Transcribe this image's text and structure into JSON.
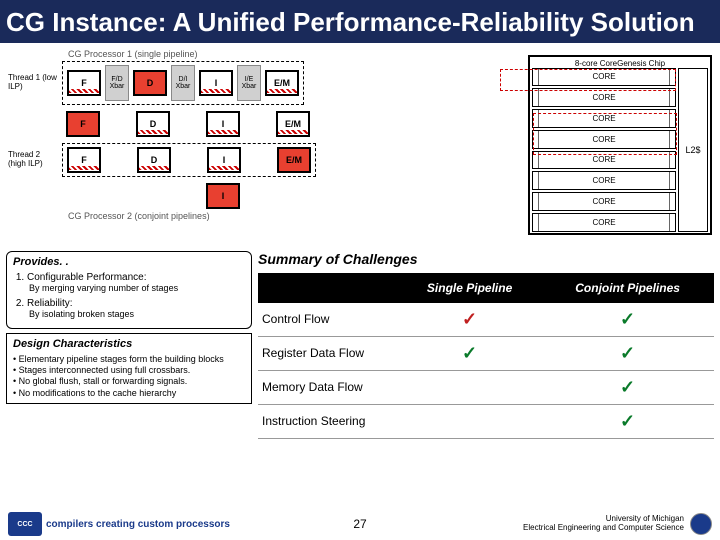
{
  "title": "CG Instance: A Unified Performance-Reliability Solution",
  "diagram": {
    "cg1_label": "CG Processor 1 (single pipeline)",
    "cg2_label": "CG Processor 2 (conjoint pipelines)",
    "thread1": "Thread 1 (low ILP)",
    "thread2": "Thread 2 (high ILP)",
    "chip_title": "8-core CoreGenesis Chip",
    "stages": {
      "F": "F",
      "D": "D",
      "I": "I",
      "EM": "E/M"
    },
    "xbars": {
      "fd": "F/D Xbar",
      "di": "D/I Xbar",
      "ie": "I/E Xbar"
    },
    "core": "CORE",
    "l2": "L2$"
  },
  "provides": {
    "header": "Provides. .",
    "items": [
      {
        "title": "Configurable Performance:",
        "sub": "By merging varying number of stages"
      },
      {
        "title": "Reliability:",
        "sub": "By isolating broken stages"
      }
    ]
  },
  "design": {
    "header": "Design Characteristics",
    "bullets": [
      "Elementary pipeline stages form the building blocks",
      "Stages interconnected using full crossbars.",
      "No global flush, stall or forwarding signals.",
      "No modifications to the cache hierarchy"
    ]
  },
  "summary": {
    "header": "Summary of Challenges",
    "col1": "Single Pipeline",
    "col2": "Conjoint Pipelines",
    "rows": [
      {
        "label": "Control Flow",
        "c1": "✓",
        "c2": "✓"
      },
      {
        "label": "Register Data Flow",
        "c1": "✓",
        "c2": "✓"
      },
      {
        "label": "Memory Data Flow",
        "c1": "",
        "c2": "✓"
      },
      {
        "label": "Instruction Steering",
        "c1": "",
        "c2": "✓"
      }
    ]
  },
  "footer": {
    "logo": "CCC",
    "logo_text": "compilers creating custom processors",
    "page": "27",
    "org1": "University of Michigan",
    "org2": "Electrical Engineering and Computer Science"
  }
}
